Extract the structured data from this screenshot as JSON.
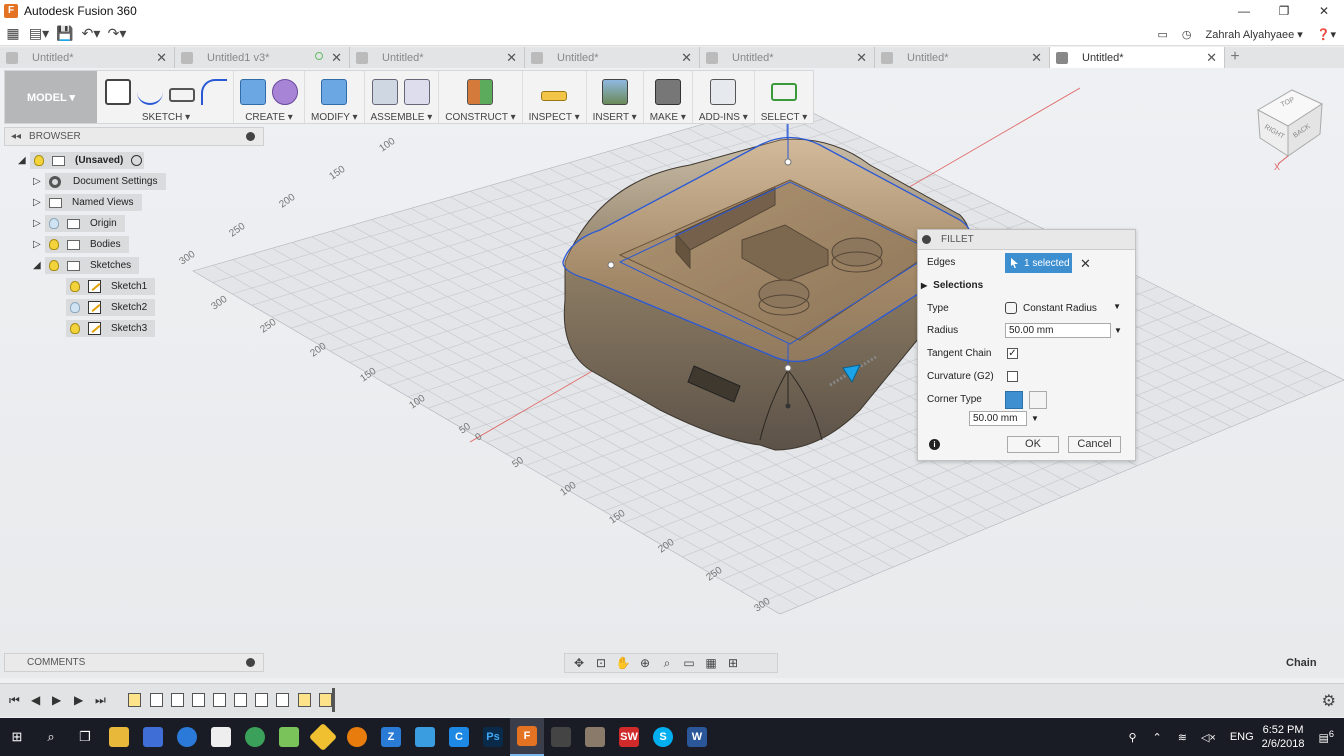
{
  "window": {
    "title": "Autodesk Fusion 360"
  },
  "appbar": {
    "user": "Zahrah Alyahyaee"
  },
  "tabs": [
    {
      "label": "Untitled*",
      "active": false
    },
    {
      "label": "Untitled1 v3*",
      "active": false
    },
    {
      "label": "Untitled*",
      "active": false
    },
    {
      "label": "Untitled*",
      "active": false
    },
    {
      "label": "Untitled*",
      "active": false
    },
    {
      "label": "Untitled*",
      "active": false
    },
    {
      "label": "Untitled*",
      "active": true
    }
  ],
  "toolbar": {
    "workspace": "MODEL ▾",
    "groups": [
      "SKETCH ▾",
      "CREATE ▾",
      "MODIFY ▾",
      "ASSEMBLE ▾",
      "CONSTRUCT ▾",
      "INSPECT ▾",
      "INSERT ▾",
      "MAKE ▾",
      "ADD-INS ▾",
      "SELECT ▾"
    ]
  },
  "browser": {
    "header": "BROWSER",
    "root": "(Unsaved)",
    "items": [
      "Document Settings",
      "Named Views",
      "Origin",
      "Bodies",
      "Sketches"
    ],
    "sketches": [
      "Sketch1",
      "Sketch2",
      "Sketch3"
    ]
  },
  "comments": {
    "label": "COMMENTS"
  },
  "viewcube": {
    "faces": [
      "TOP",
      "RIGHT",
      "BACK"
    ]
  },
  "grid": {
    "ticks": [
      "100",
      "150",
      "200",
      "250",
      "300",
      "300",
      "250",
      "200",
      "150",
      "100",
      "50",
      "0",
      "50",
      "100",
      "150",
      "200",
      "250",
      "300"
    ]
  },
  "fillet": {
    "title": "FILLET",
    "edges_label": "Edges",
    "edges_value": "1 selected",
    "selections_label": "Selections",
    "type_label": "Type",
    "type_value": "Constant Radius",
    "radius_label": "Radius",
    "radius_value": "50.00 mm",
    "tangent_label": "Tangent Chain",
    "tangent_checked": true,
    "curvature_label": "Curvature (G2)",
    "curvature_checked": false,
    "corner_label": "Corner Type",
    "corner_value": "50.00 mm",
    "ok": "OK",
    "cancel": "Cancel"
  },
  "status": {
    "chain": "Chain"
  },
  "taskbar": {
    "lang": "ENG",
    "time": "6:52 PM",
    "date": "2/6/2018",
    "notifications": "6"
  },
  "colors": {
    "accent": "#3d8fd0",
    "body": "#7a6a52",
    "edge_highlight": "#2a59d6"
  }
}
